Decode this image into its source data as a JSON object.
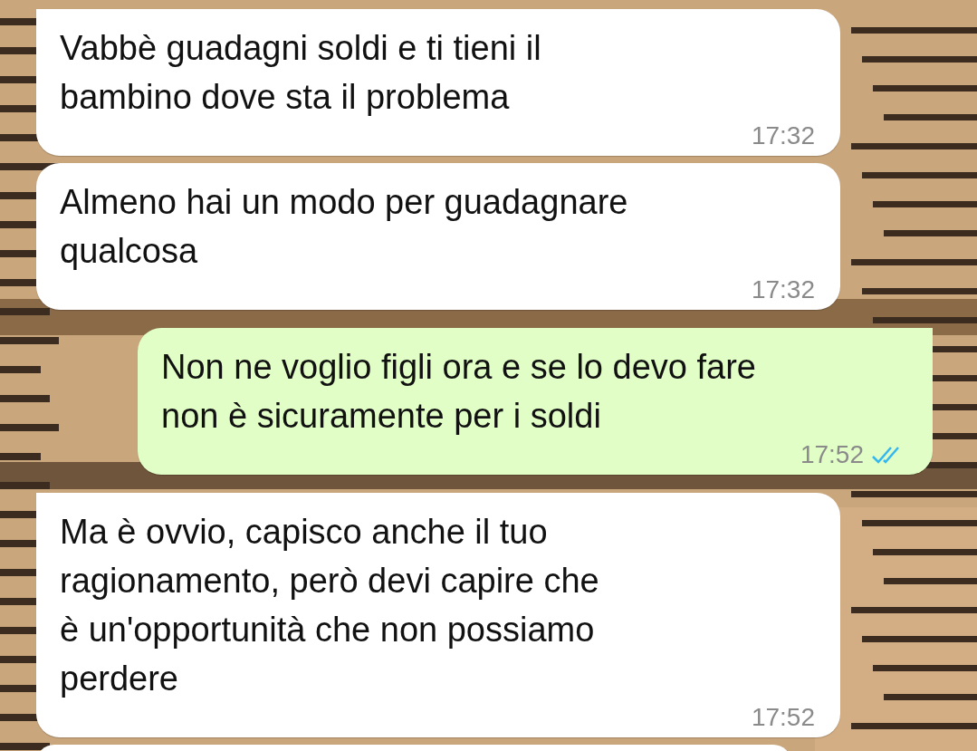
{
  "messages": [
    {
      "kind": "incoming",
      "text": "Vabbè guadagni soldi e ti tieni il\nbambino dove sta il problema",
      "time": "17:32",
      "tail": true
    },
    {
      "kind": "incoming",
      "text": "Almeno hai un modo per guadagnare\nqualcosa",
      "time": "17:32",
      "tail": false
    },
    {
      "kind": "outgoing",
      "text": "Non ne voglio figli ora e se lo devo fare\nnon è sicuramente per i soldi",
      "time": "17:52",
      "tail": true,
      "read": true
    },
    {
      "kind": "incoming",
      "text": "Ma è ovvio, capisco anche il tuo\nragionamento, però devi capire che\nè un'opportunità che non possiamo\nperdere",
      "time": "17:52",
      "tail": true
    }
  ]
}
